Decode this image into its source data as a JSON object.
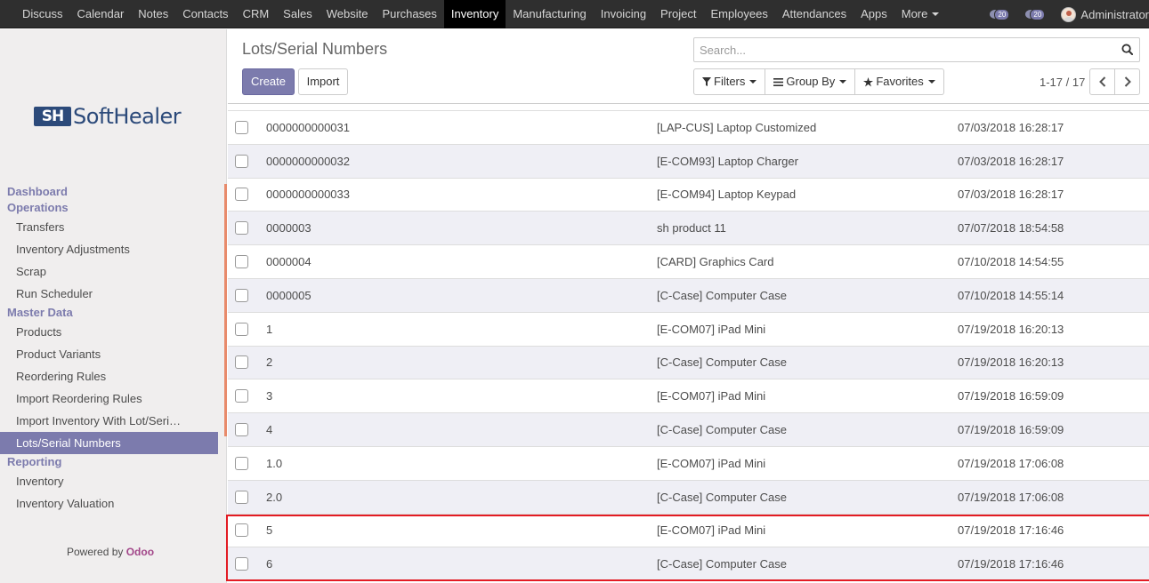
{
  "navbar": {
    "items": [
      "Discuss",
      "Calendar",
      "Notes",
      "Contacts",
      "CRM",
      "Sales",
      "Website",
      "Purchases",
      "Inventory",
      "Manufacturing",
      "Invoicing",
      "Project",
      "Employees",
      "Attendances",
      "Apps"
    ],
    "active": "Inventory",
    "more_label": "More",
    "activity_count": "20",
    "message_count": "20",
    "user_name": "Administrator"
  },
  "sidebar": {
    "logo_mark": "SH",
    "logo_text": "SoftHealer",
    "menu": [
      {
        "type": "section",
        "label": "Dashboard"
      },
      {
        "type": "section",
        "label": "Operations"
      },
      {
        "type": "item",
        "label": "Transfers"
      },
      {
        "type": "item",
        "label": "Inventory Adjustments"
      },
      {
        "type": "item",
        "label": "Scrap"
      },
      {
        "type": "item",
        "label": "Run Scheduler"
      },
      {
        "type": "section",
        "label": "Master Data"
      },
      {
        "type": "item",
        "label": "Products"
      },
      {
        "type": "item",
        "label": "Product Variants"
      },
      {
        "type": "item",
        "label": "Reordering Rules"
      },
      {
        "type": "item",
        "label": "Import Reordering Rules"
      },
      {
        "type": "item",
        "label": "Import Inventory With Lot/Seri…"
      },
      {
        "type": "item",
        "label": "Lots/Serial Numbers",
        "active": true
      },
      {
        "type": "section",
        "label": "Reporting"
      },
      {
        "type": "item",
        "label": "Inventory"
      },
      {
        "type": "item",
        "label": "Inventory Valuation"
      }
    ],
    "powered_prefix": "Powered by",
    "powered_brand": "Odoo"
  },
  "control_panel": {
    "title": "Lots/Serial Numbers",
    "create_label": "Create",
    "import_label": "Import",
    "search_placeholder": "Search...",
    "filters_label": "Filters",
    "group_by_label": "Group By",
    "favorites_label": "Favorites",
    "pager": "1-17 / 17"
  },
  "records": [
    {
      "name": "0000000000031",
      "product": "[LAP-CUS] Laptop Customized",
      "date": "07/03/2018 16:28:17"
    },
    {
      "name": "0000000000032",
      "product": "[E-COM93] Laptop Charger",
      "date": "07/03/2018 16:28:17"
    },
    {
      "name": "0000000000033",
      "product": "[E-COM94] Laptop Keypad",
      "date": "07/03/2018 16:28:17"
    },
    {
      "name": "0000003",
      "product": "sh product 11",
      "date": "07/07/2018 18:54:58"
    },
    {
      "name": "0000004",
      "product": "[CARD] Graphics Card",
      "date": "07/10/2018 14:54:55"
    },
    {
      "name": "0000005",
      "product": "[C-Case] Computer Case",
      "date": "07/10/2018 14:55:14"
    },
    {
      "name": "1",
      "product": "[E-COM07] iPad Mini",
      "date": "07/19/2018 16:20:13"
    },
    {
      "name": "2",
      "product": "[C-Case] Computer Case",
      "date": "07/19/2018 16:20:13"
    },
    {
      "name": "3",
      "product": "[E-COM07] iPad Mini",
      "date": "07/19/2018 16:59:09"
    },
    {
      "name": "4",
      "product": "[C-Case] Computer Case",
      "date": "07/19/2018 16:59:09"
    },
    {
      "name": "1.0",
      "product": "[E-COM07] iPad Mini",
      "date": "07/19/2018 17:06:08"
    },
    {
      "name": "2.0",
      "product": "[C-Case] Computer Case",
      "date": "07/19/2018 17:06:08"
    },
    {
      "name": "5",
      "product": "[E-COM07] iPad Mini",
      "date": "07/19/2018 17:16:46"
    },
    {
      "name": "6",
      "product": "[C-Case] Computer Case",
      "date": "07/19/2018 17:16:46"
    }
  ],
  "colors": {
    "brand": "#7c7bad",
    "navbar": "#2f2f2f",
    "highlight": "#e31b23",
    "accent": "#e88a6b"
  }
}
